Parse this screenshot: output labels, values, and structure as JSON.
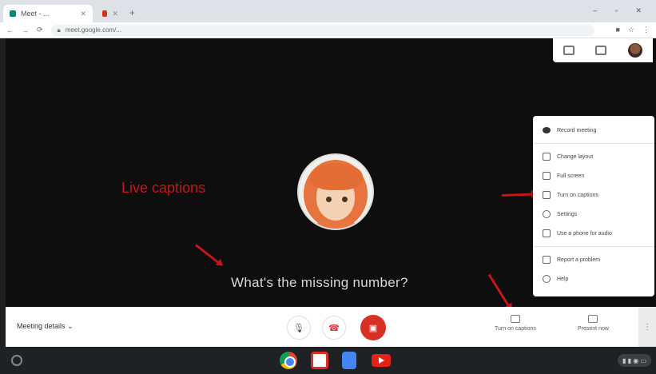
{
  "browser": {
    "tabs": [
      {
        "title": "Meet - ...",
        "favicon_color": "#00897b"
      },
      {
        "title": "",
        "favicon_color": "#d93025"
      }
    ],
    "url": "meet.google.com/..."
  },
  "stage": {
    "caption": "What's the missing number?"
  },
  "annotation": {
    "label": "Live captions",
    "color": "#c6151b"
  },
  "menu": {
    "items": [
      {
        "label": "Record meeting",
        "icon": "record-icon"
      },
      {
        "label": "Change layout",
        "icon": "layout-icon"
      },
      {
        "label": "Full screen",
        "icon": "fullscreen-icon"
      },
      {
        "label": "Turn on captions",
        "icon": "captions-icon"
      },
      {
        "label": "Settings",
        "icon": "gear-icon"
      },
      {
        "label": "Use a phone for audio",
        "icon": "phone-icon"
      },
      {
        "label": "Report a problem",
        "icon": "report-icon"
      },
      {
        "label": "Help",
        "icon": "help-icon"
      }
    ]
  },
  "bottombar": {
    "meeting_details": "Meeting details",
    "captions_label": "Turn on captions",
    "present_label": "Present now"
  }
}
